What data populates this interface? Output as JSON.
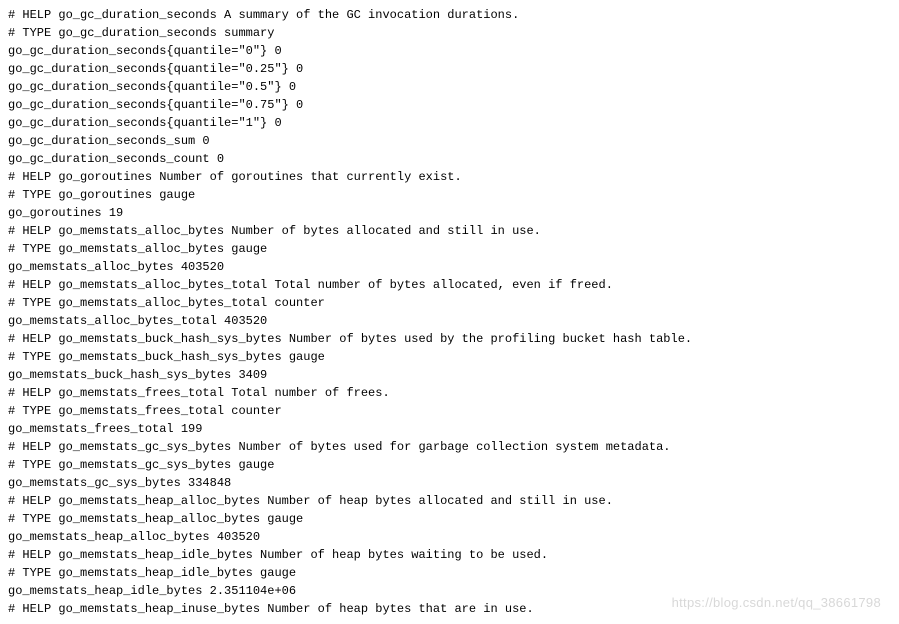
{
  "lines": [
    "# HELP go_gc_duration_seconds A summary of the GC invocation durations.",
    "# TYPE go_gc_duration_seconds summary",
    "go_gc_duration_seconds{quantile=\"0\"} 0",
    "go_gc_duration_seconds{quantile=\"0.25\"} 0",
    "go_gc_duration_seconds{quantile=\"0.5\"} 0",
    "go_gc_duration_seconds{quantile=\"0.75\"} 0",
    "go_gc_duration_seconds{quantile=\"1\"} 0",
    "go_gc_duration_seconds_sum 0",
    "go_gc_duration_seconds_count 0",
    "# HELP go_goroutines Number of goroutines that currently exist.",
    "# TYPE go_goroutines gauge",
    "go_goroutines 19",
    "# HELP go_memstats_alloc_bytes Number of bytes allocated and still in use.",
    "# TYPE go_memstats_alloc_bytes gauge",
    "go_memstats_alloc_bytes 403520",
    "# HELP go_memstats_alloc_bytes_total Total number of bytes allocated, even if freed.",
    "# TYPE go_memstats_alloc_bytes_total counter",
    "go_memstats_alloc_bytes_total 403520",
    "# HELP go_memstats_buck_hash_sys_bytes Number of bytes used by the profiling bucket hash table.",
    "# TYPE go_memstats_buck_hash_sys_bytes gauge",
    "go_memstats_buck_hash_sys_bytes 3409",
    "# HELP go_memstats_frees_total Total number of frees.",
    "# TYPE go_memstats_frees_total counter",
    "go_memstats_frees_total 199",
    "# HELP go_memstats_gc_sys_bytes Number of bytes used for garbage collection system metadata.",
    "# TYPE go_memstats_gc_sys_bytes gauge",
    "go_memstats_gc_sys_bytes 334848",
    "# HELP go_memstats_heap_alloc_bytes Number of heap bytes allocated and still in use.",
    "# TYPE go_memstats_heap_alloc_bytes gauge",
    "go_memstats_heap_alloc_bytes 403520",
    "# HELP go_memstats_heap_idle_bytes Number of heap bytes waiting to be used.",
    "# TYPE go_memstats_heap_idle_bytes gauge",
    "go_memstats_heap_idle_bytes 2.351104e+06",
    "# HELP go_memstats_heap_inuse_bytes Number of heap bytes that are in use."
  ],
  "watermark": "https://blog.csdn.net/qq_38661798"
}
